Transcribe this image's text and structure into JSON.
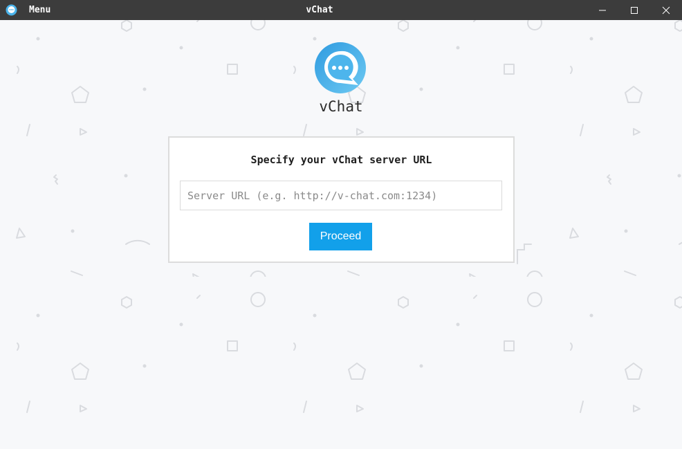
{
  "titlebar": {
    "menu_label": "Menu",
    "window_title": "vChat",
    "icons": {
      "app": "chat-bubble-icon",
      "minimize": "minimize-icon",
      "maximize": "maximize-icon",
      "close": "close-icon"
    }
  },
  "brand": {
    "app_name": "vChat",
    "logo_icon": "chat-bubble-logo-icon",
    "accent_color": "#12a0ea"
  },
  "server_form": {
    "heading": "Specify your vChat server URL",
    "url_value": "",
    "url_placeholder": "Server URL (e.g. http://v-chat.com:1234)",
    "proceed_label": "Proceed"
  }
}
